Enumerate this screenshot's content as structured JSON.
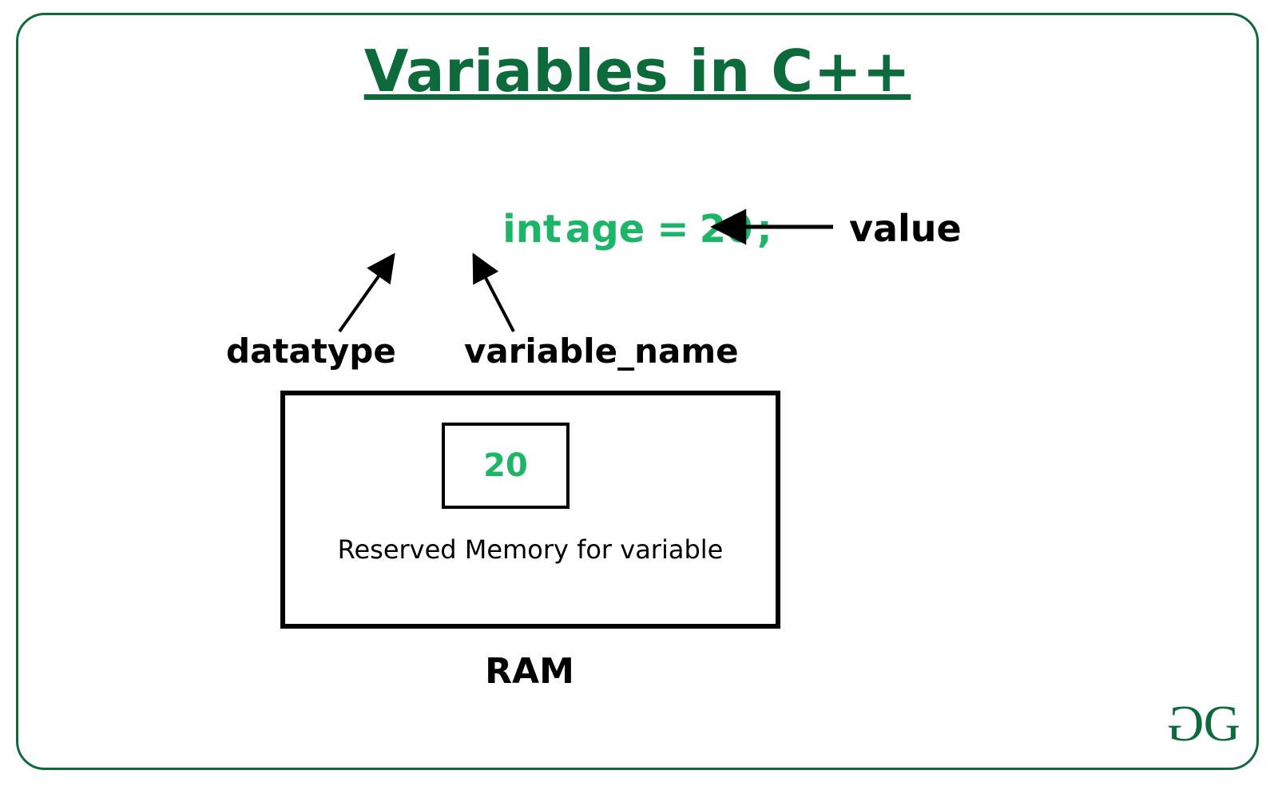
{
  "title": "Variables in C++",
  "code": {
    "datatype": "int",
    "name": "age",
    "eq": "=",
    "value": "20",
    "semicolon": ";"
  },
  "labels": {
    "value": "value",
    "datatype": "datatype",
    "variable_name": "variable_name",
    "ram": "RAM",
    "reserved_memory": "Reserved Memory for variable"
  },
  "memory": {
    "cell_value": "20"
  },
  "brand": {
    "g1": "G",
    "g2": "G"
  }
}
